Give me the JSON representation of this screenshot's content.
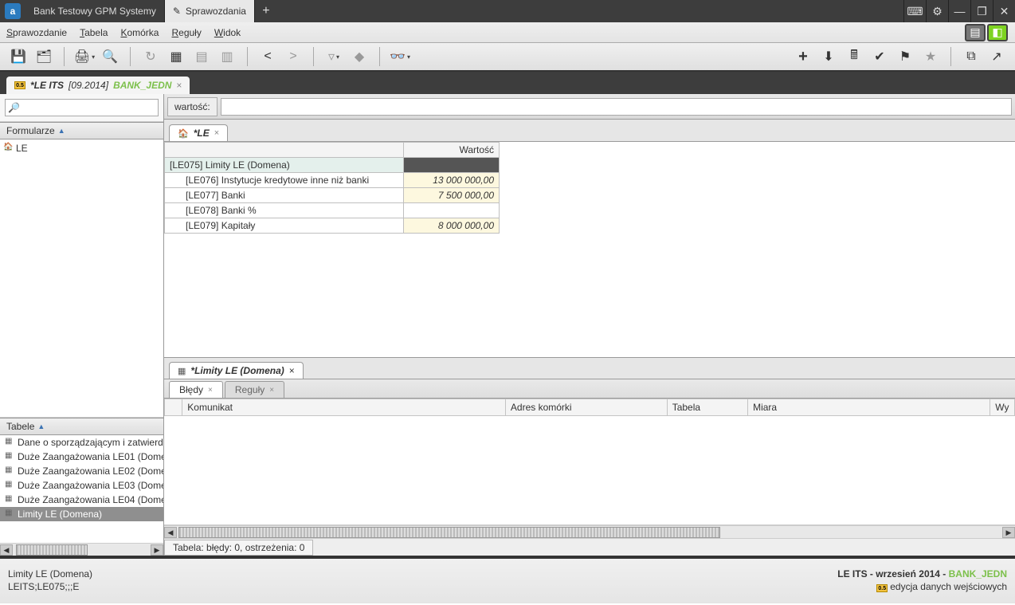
{
  "title_tabs": [
    {
      "label": "Bank Testowy GPM Systemy",
      "active": false
    },
    {
      "label": "Sprawozdania",
      "active": true
    }
  ],
  "menus": {
    "sprawozdanie": "Sprawozdanie",
    "tabela": "Tabela",
    "komorka": "Komórka",
    "reguly": "Reguły",
    "widok": "Widok"
  },
  "doctab": {
    "main": "*LE ITS",
    "date": "[09.2014]",
    "bank": "BANK_JEDN"
  },
  "left": {
    "formularze_hdr": "Formularze",
    "tree_item": "LE",
    "tabele_hdr": "Tabele",
    "tabele": [
      "Dane o sporządzającym i zatwierd",
      "Duże Zaangażowania LE01 (Dome",
      "Duże Zaangażowania LE02 (Dome",
      "Duże Zaangażowania LE03 (Dome",
      "Duże Zaangażowania LE04 (Dome",
      "Limity LE (Domena)"
    ],
    "tabele_selected": 5
  },
  "right": {
    "value_label": "wartość:",
    "value_text": "",
    "sheet_tab": "*LE",
    "grid": {
      "col_header": "Wartość",
      "rows": [
        {
          "label": "[LE075] Limity LE (Domena)",
          "value": "",
          "section": true
        },
        {
          "label": "[LE076] Instytucje kredytowe inne niż banki",
          "value": "13 000 000,00"
        },
        {
          "label": "[LE077] Banki",
          "value": "7 500 000,00"
        },
        {
          "label": "[LE078] Banki %",
          "value": ""
        },
        {
          "label": "[LE079] Kapitały",
          "value": "8 000 000,00"
        }
      ]
    },
    "lower_tab": "*Limity LE (Domena)",
    "err_tabs": {
      "bledy": "Błędy",
      "reguly": "Reguły"
    },
    "err_cols": [
      "",
      "Komunikat",
      "Adres komórki",
      "Tabela",
      "Miara",
      "Wy"
    ],
    "err_status": "Tabela: błędy: 0, ostrzeżenia: 0"
  },
  "status": {
    "l1": "Limity LE (Domena)",
    "l2": "LEITS;LE075;;;E",
    "r1a": "LE ITS - wrzesień 2014 - ",
    "r1b": "BANK_JEDN",
    "r2": "edycja danych wejściowych"
  }
}
